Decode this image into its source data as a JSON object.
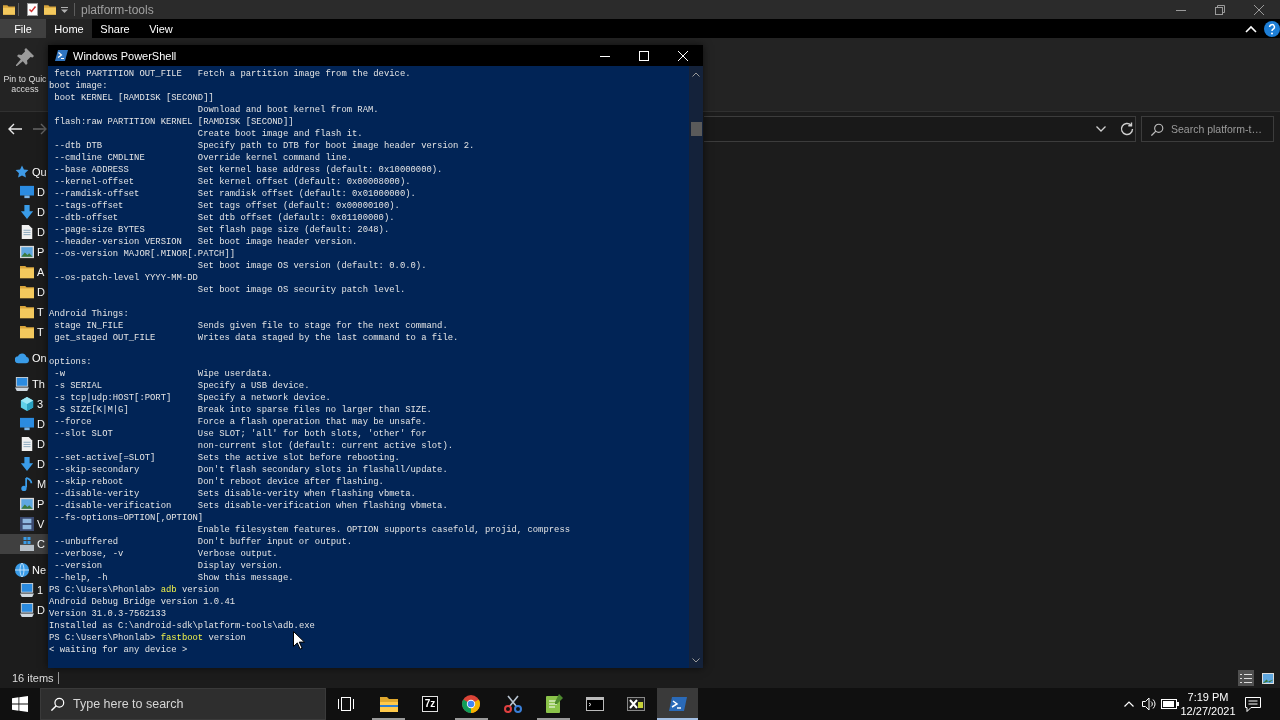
{
  "explorer": {
    "title": "platform-tools",
    "ribbon_tabs": [
      {
        "label": "File",
        "kind": "menu",
        "selected": false
      },
      {
        "label": "Home",
        "kind": "tab",
        "selected": true
      },
      {
        "label": "Share",
        "kind": "tab",
        "selected": false
      },
      {
        "label": "View",
        "kind": "tab",
        "selected": false
      }
    ],
    "ribbon_buttons": [
      {
        "label": "Pin to Quic\naccess"
      }
    ],
    "nav_buttons": [
      {
        "kind": "back",
        "disabled": false
      },
      {
        "kind": "forward",
        "disabled": true
      }
    ],
    "search": {
      "placeholder": "Search platform-t…"
    },
    "navigation": [
      {
        "label": "Qu",
        "kind": "star",
        "selected": false,
        "children": [
          {
            "label": "D",
            "kind": "desktop",
            "selected": false
          },
          {
            "label": "D",
            "kind": "download",
            "selected": false
          },
          {
            "label": "D",
            "kind": "document",
            "selected": false
          },
          {
            "label": "P",
            "kind": "pictures",
            "selected": false
          },
          {
            "label": "A",
            "kind": "folder",
            "selected": false
          },
          {
            "label": "D",
            "kind": "folder",
            "selected": false
          },
          {
            "label": "T",
            "kind": "folder",
            "selected": false
          },
          {
            "label": "T",
            "kind": "folder",
            "selected": false
          }
        ]
      },
      {
        "label": "On",
        "kind": "cloud",
        "selected": false
      },
      {
        "label": "Th",
        "kind": "computer",
        "selected": false,
        "children": [
          {
            "label": "3",
            "kind": "cube",
            "selected": false
          },
          {
            "label": "D",
            "kind": "desktop",
            "selected": false
          },
          {
            "label": "D",
            "kind": "document",
            "selected": false
          },
          {
            "label": "D",
            "kind": "download",
            "selected": false
          },
          {
            "label": "M",
            "kind": "music",
            "selected": false
          },
          {
            "label": "P",
            "kind": "pictures",
            "selected": false
          },
          {
            "label": "V",
            "kind": "video",
            "selected": false
          },
          {
            "label": "C",
            "kind": "drive",
            "selected": true
          }
        ]
      },
      {
        "label": "Ne",
        "kind": "network",
        "selected": false,
        "children": [
          {
            "label": "1",
            "kind": "computer",
            "selected": false
          },
          {
            "label": "D",
            "kind": "computer",
            "selected": false
          }
        ]
      }
    ],
    "status_bar": {
      "item_count": "16 items",
      "view_modes": [
        {
          "kind": "details",
          "selected": true
        },
        {
          "kind": "large_icons",
          "selected": false
        }
      ]
    }
  },
  "powershell": {
    "title": "Windows PowerShell",
    "lines": [
      {
        "kind": "option",
        "option": "fetch PARTITION OUT_FILE",
        "description": "Fetch a partition image from the device."
      },
      {
        "kind": "heading",
        "text": "boot image:"
      },
      {
        "kind": "option",
        "option": "boot KERNEL [RAMDISK [SECOND]]"
      },
      {
        "kind": "detail",
        "text": "Download and boot kernel from RAM."
      },
      {
        "kind": "option",
        "option": "flash:raw PARTITION KERNEL [RAMDISK [SECOND]]"
      },
      {
        "kind": "detail",
        "text": "Create boot image and flash it."
      },
      {
        "kind": "option",
        "option": "--dtb DTB",
        "description": "Specify path to DTB for boot image header version 2."
      },
      {
        "kind": "option",
        "option": "--cmdline CMDLINE",
        "description": "Override kernel command line."
      },
      {
        "kind": "option",
        "option": "--base ADDRESS",
        "description": "Set kernel base address (default: 0x10000000)."
      },
      {
        "kind": "option",
        "option": "--kernel-offset",
        "description": "Set kernel offset (default: 0x00008000)."
      },
      {
        "kind": "option",
        "option": "--ramdisk-offset",
        "description": "Set ramdisk offset (default: 0x01000000)."
      },
      {
        "kind": "option",
        "option": "--tags-offset",
        "description": "Set tags offset (default: 0x00000100)."
      },
      {
        "kind": "option",
        "option": "--dtb-offset",
        "description": "Set dtb offset (default: 0x01100000)."
      },
      {
        "kind": "option",
        "option": "--page-size BYTES",
        "description": "Set flash page size (default: 2048)."
      },
      {
        "kind": "option",
        "option": "--header-version VERSION",
        "description": "Set boot image header version."
      },
      {
        "kind": "option",
        "option": "--os-version MAJOR[.MINOR[.PATCH]]"
      },
      {
        "kind": "detail",
        "text": "Set boot image OS version (default: 0.0.0)."
      },
      {
        "kind": "option",
        "option": "--os-patch-level YYYY-MM-DD"
      },
      {
        "kind": "detail",
        "text": "Set boot image OS security patch level."
      },
      {
        "kind": "blank"
      },
      {
        "kind": "heading",
        "text": "Android Things:"
      },
      {
        "kind": "option",
        "option": "stage IN_FILE",
        "description": "Sends given file to stage for the next command."
      },
      {
        "kind": "option",
        "option": "get_staged OUT_FILE",
        "description": "Writes data staged by the last command to a file."
      },
      {
        "kind": "blank"
      },
      {
        "kind": "heading",
        "text": "options:"
      },
      {
        "kind": "option",
        "option": "-w",
        "description": "Wipe userdata."
      },
      {
        "kind": "option",
        "option": "-s SERIAL",
        "description": "Specify a USB device."
      },
      {
        "kind": "option",
        "option": "-s tcp|udp:HOST[:PORT]",
        "description": "Specify a network device."
      },
      {
        "kind": "option",
        "option": "-S SIZE[K|M|G]",
        "description": "Break into sparse files no larger than SIZE."
      },
      {
        "kind": "option",
        "option": "--force",
        "description": "Force a flash operation that may be unsafe."
      },
      {
        "kind": "option",
        "option": "--slot SLOT",
        "description": "Use SLOT; 'all' for both slots, 'other' for"
      },
      {
        "kind": "detail",
        "text": "non-current slot (default: current active slot)."
      },
      {
        "kind": "option",
        "option": "--set-active[=SLOT]",
        "description": "Sets the active slot before rebooting."
      },
      {
        "kind": "option",
        "option": "--skip-secondary",
        "description": "Don't flash secondary slots in flashall/update."
      },
      {
        "kind": "option",
        "option": "--skip-reboot",
        "description": "Don't reboot device after flashing."
      },
      {
        "kind": "option",
        "option": "--disable-verity",
        "description": "Sets disable-verity when flashing vbmeta."
      },
      {
        "kind": "option",
        "option": "--disable-verification",
        "description": "Sets disable-verification when flashing vbmeta."
      },
      {
        "kind": "option",
        "option": "--fs-options=OPTION[,OPTION]"
      },
      {
        "kind": "detail",
        "text": "Enable filesystem features. OPTION supports casefold, projid, compress"
      },
      {
        "kind": "option",
        "option": "--unbuffered",
        "description": "Don't buffer input or output."
      },
      {
        "kind": "option",
        "option": "--verbose, -v",
        "description": "Verbose output."
      },
      {
        "kind": "option",
        "option": "--version",
        "description": "Display version."
      },
      {
        "kind": "option",
        "option": "--help, -h",
        "description": "Show this message."
      },
      {
        "kind": "prompt",
        "prompt": "PS C:\\Users\\Phonlab>",
        "command": "adb",
        "args": "version"
      },
      {
        "kind": "output",
        "text": "Android Debug Bridge version 1.0.41"
      },
      {
        "kind": "output",
        "text": "Version 31.0.3-7562133"
      },
      {
        "kind": "output",
        "text": "Installed as C:\\android-sdk\\platform-tools\\adb.exe"
      },
      {
        "kind": "prompt",
        "prompt": "PS C:\\Users\\Phonlab>",
        "command": "fastboot",
        "args": "version"
      },
      {
        "kind": "output",
        "text": "< waiting for any device >"
      }
    ]
  },
  "taskbar": {
    "search": {
      "placeholder": "Type here to search"
    },
    "apps": [
      {
        "kind": "folder",
        "running": true,
        "selected": false
      },
      {
        "kind": "archive",
        "label": "7z",
        "running": false,
        "selected": false
      },
      {
        "kind": "browser",
        "running": true,
        "selected": false
      },
      {
        "kind": "scissors",
        "running": false,
        "selected": false
      },
      {
        "kind": "notepad",
        "running": true,
        "selected": false
      },
      {
        "kind": "console",
        "running": false,
        "selected": false
      },
      {
        "kind": "tile",
        "running": false,
        "selected": false
      },
      {
        "kind": "shell",
        "running": true,
        "selected": true
      }
    ],
    "clock": {
      "time": "7:19 PM",
      "date": "12/27/2021"
    }
  }
}
